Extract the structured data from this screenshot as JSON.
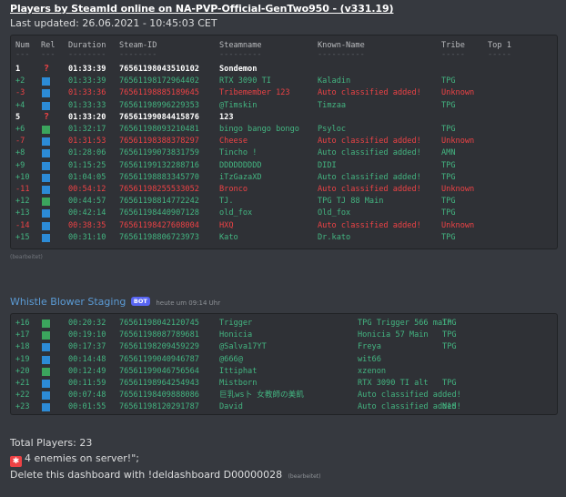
{
  "header": {
    "title": "Players by SteamId online on NA-PVP-Official-GenTwo950 - (v331.19)",
    "last_updated": "Last updated: 26.06.2021 - 10:45:03 CET"
  },
  "table": {
    "columns": [
      "Num",
      "Rel",
      "Duration",
      "Steam-ID",
      "Steamname",
      "Known-Name",
      "Tribe",
      "Top 1"
    ],
    "dashes": [
      "---",
      "---",
      "--------",
      "--------",
      "---------",
      "----------",
      "-----",
      "-----"
    ],
    "rows": [
      {
        "num": "1",
        "rel": "?",
        "duration": "01:33:39",
        "steamid": "76561198043510102",
        "name": "Sondemon",
        "known": "",
        "tribe": "",
        "style": "bold"
      },
      {
        "num": "+2",
        "rel": "blue",
        "duration": "01:33:39",
        "steamid": "76561198172964402",
        "name": "RTX 3090 TI",
        "known": "Kaladin",
        "tribe": "TPG",
        "style": "green"
      },
      {
        "num": "-3",
        "rel": "blue",
        "duration": "01:33:36",
        "steamid": "76561198885189645",
        "name": "Tribemember 123",
        "known": "Auto classified added!",
        "tribe": "Unknown",
        "style": "red"
      },
      {
        "num": "+4",
        "rel": "blue",
        "duration": "01:33:33",
        "steamid": "76561198996229353",
        "name": "@Timskin",
        "known": "Timzaa",
        "tribe": "TPG",
        "style": "green"
      },
      {
        "num": "5",
        "rel": "?",
        "duration": "01:33:20",
        "steamid": "76561199084415876",
        "name": "123",
        "known": "",
        "tribe": "",
        "style": "bold"
      },
      {
        "num": "+6",
        "rel": "green",
        "duration": "01:32:17",
        "steamid": "76561198093210481",
        "name": "bingo bango bongo",
        "known": "Psyloc",
        "tribe": "TPG",
        "style": "green"
      },
      {
        "num": "-7",
        "rel": "blue",
        "duration": "01:31:53",
        "steamid": "76561198388378297",
        "name": "Cheese",
        "known": "Auto classified added!",
        "tribe": "Unknown",
        "style": "red"
      },
      {
        "num": "+8",
        "rel": "blue",
        "duration": "01:28:06",
        "steamid": "76561199073831759",
        "name": "Tincho !",
        "known": "Auto classified added!",
        "tribe": "AMN",
        "style": "green"
      },
      {
        "num": "+9",
        "rel": "blue",
        "duration": "01:15:25",
        "steamid": "76561199132288716",
        "name": "DDDDDDDDD",
        "known": "DIDI",
        "tribe": "TPG",
        "style": "green"
      },
      {
        "num": "+10",
        "rel": "blue",
        "duration": "01:04:05",
        "steamid": "76561198883345770",
        "name": "iTzGazaXD",
        "known": "Auto classified added!",
        "tribe": "TPG",
        "style": "green"
      },
      {
        "num": "-11",
        "rel": "blue",
        "duration": "00:54:12",
        "steamid": "76561198255533052",
        "name": "Bronco",
        "known": "Auto classified added!",
        "tribe": "Unknown",
        "style": "red"
      },
      {
        "num": "+12",
        "rel": "green",
        "duration": "00:44:57",
        "steamid": "76561198814772242",
        "name": "TJ.",
        "known": "TPG TJ 88 Main",
        "tribe": "TPG",
        "style": "green"
      },
      {
        "num": "+13",
        "rel": "blue",
        "duration": "00:42:14",
        "steamid": "76561198440907128",
        "name": "old_fox",
        "known": "Old_fox",
        "tribe": "TPG",
        "style": "green"
      },
      {
        "num": "-14",
        "rel": "blue",
        "duration": "00:38:35",
        "steamid": "76561198427608004",
        "name": "HXQ",
        "known": "Auto classified added!",
        "tribe": "Unknown",
        "style": "red"
      },
      {
        "num": "+15",
        "rel": "blue",
        "duration": "00:31:10",
        "steamid": "76561198806723973",
        "name": "Kato",
        "known": "Dr.kato",
        "tribe": "TPG",
        "style": "green"
      }
    ]
  },
  "edited_label": "(bearbeitet)",
  "message2": {
    "author": "Whistle Blower Staging",
    "bot_badge": "BOT",
    "timestamp": "heute um 09:14 Uhr"
  },
  "table2": {
    "rows": [
      {
        "num": "+16",
        "rel": "green",
        "duration": "00:20:32",
        "steamid": "76561198042120745",
        "name": "Trigger",
        "known": "TPG Trigger 566 main",
        "tribe": "TPG",
        "style": "green"
      },
      {
        "num": "+17",
        "rel": "green",
        "duration": "00:19:10",
        "steamid": "76561198087789681",
        "name": "Honicia",
        "known": "Honicia 57 Main",
        "tribe": "TPG",
        "style": "green"
      },
      {
        "num": "+18",
        "rel": "blue",
        "duration": "00:17:37",
        "steamid": "76561198209459229",
        "name": "@Salva17YT",
        "known": "Freya",
        "tribe": "TPG",
        "style": "green"
      },
      {
        "num": "+19",
        "rel": "blue",
        "duration": "00:14:48",
        "steamid": "76561199040946787",
        "name": "@666@",
        "known": "wit66",
        "tribe": "",
        "style": "green"
      },
      {
        "num": "+20",
        "rel": "green",
        "duration": "00:12:49",
        "steamid": "76561199046756564",
        "name": "Ittiphat",
        "known": "xzenon",
        "tribe": "",
        "style": "green"
      },
      {
        "num": "+21",
        "rel": "blue",
        "duration": "00:11:59",
        "steamid": "76561198964254943",
        "name": "Mistborn",
        "known": "RTX 3090 TI alt",
        "tribe": "TPG",
        "style": "green"
      },
      {
        "num": "+22",
        "rel": "blue",
        "duration": "00:07:48",
        "steamid": "76561198409888086",
        "name": "巨乳ws卜 女教師の美飢",
        "known": "Auto classified added!",
        "tribe": "",
        "style": "green"
      },
      {
        "num": "+23",
        "rel": "blue",
        "duration": "00:01:55",
        "steamid": "76561198120291787",
        "name": "David",
        "known": "Auto classified added!",
        "tribe": "N1S",
        "style": "green"
      }
    ]
  },
  "footer": {
    "total": "Total Players: 23",
    "alarm_glyph": "✱",
    "enemies": "4 enemies on server!\";",
    "delete": "Delete this dashboard with !deldashboard D00000028",
    "edited": "(bearbeitet)"
  },
  "colors": {
    "background": "#36393f",
    "codeblock": "#2f3136",
    "friendly": "#43b581",
    "enemy": "#ed4245",
    "blue_square": "#2c8bd6",
    "green_square": "#3ba55d",
    "author": "#5b9bd5",
    "bot_badge": "#5865f2"
  }
}
